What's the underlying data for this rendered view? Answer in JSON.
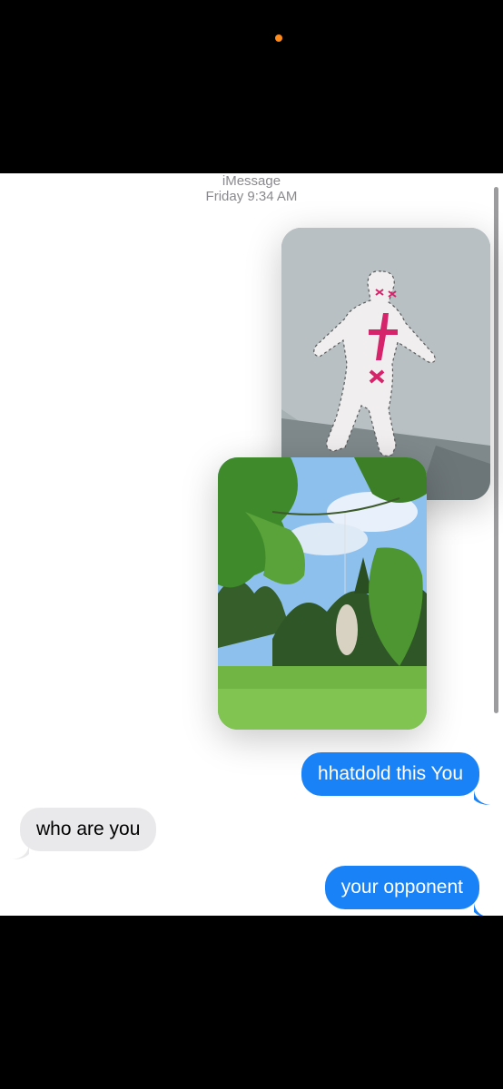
{
  "header": {
    "service": "iMessage",
    "timestamp": "Friday 9:34 AM"
  },
  "attachments": [
    {
      "kind": "photo",
      "subject": "handmade-doll-photo"
    },
    {
      "kind": "photo",
      "subject": "tree-park-photo"
    }
  ],
  "messages": [
    {
      "direction": "sent",
      "text": "hhatdold this You"
    },
    {
      "direction": "received",
      "text": "who are you"
    },
    {
      "direction": "sent",
      "text": "your opponent"
    }
  ],
  "colors": {
    "sent_bubble": "#1a82f7",
    "received_bubble": "#e9e9eb",
    "privacy_indicator": "#ff8c1a"
  }
}
